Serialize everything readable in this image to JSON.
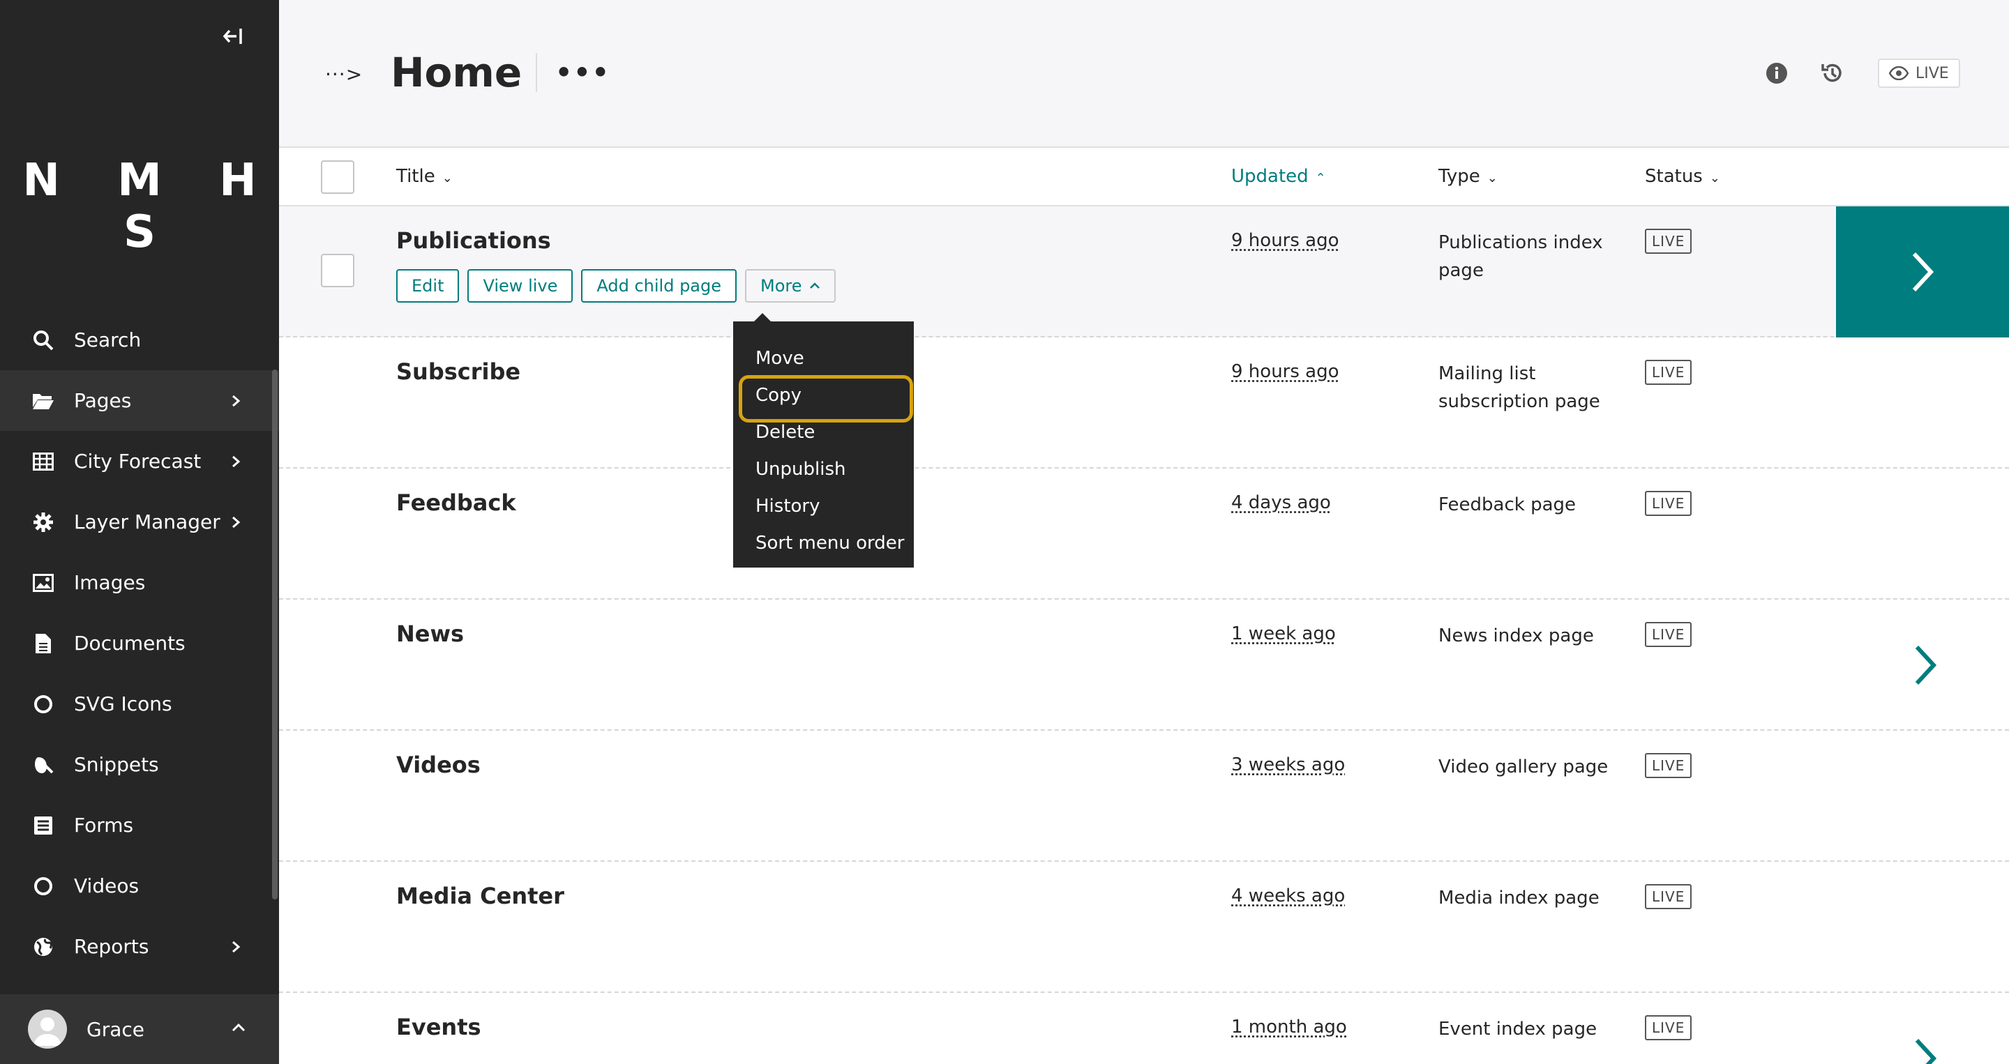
{
  "sidebar": {
    "logo": "N M H S",
    "items": [
      {
        "label": "Search",
        "icon": "search-icon",
        "has_children": false
      },
      {
        "label": "Pages",
        "icon": "folder-open-icon",
        "has_children": true
      },
      {
        "label": "City Forecast",
        "icon": "table-icon",
        "has_children": true
      },
      {
        "label": "Layer Manager",
        "icon": "gear-icon",
        "has_children": true
      },
      {
        "label": "Images",
        "icon": "image-icon",
        "has_children": false
      },
      {
        "label": "Documents",
        "icon": "document-icon",
        "has_children": false
      },
      {
        "label": "SVG Icons",
        "icon": "circle-icon",
        "has_children": false
      },
      {
        "label": "Snippets",
        "icon": "snippet-icon",
        "has_children": false
      },
      {
        "label": "Forms",
        "icon": "form-icon",
        "has_children": false
      },
      {
        "label": "Videos",
        "icon": "circle-icon",
        "has_children": false
      },
      {
        "label": "Reports",
        "icon": "globe-icon",
        "has_children": true
      }
    ],
    "account_name": "Grace"
  },
  "header": {
    "breadcrumb_toggle": "···>",
    "title": "Home",
    "more": "•••",
    "live_label": "LIVE"
  },
  "table": {
    "columns": {
      "title": "Title",
      "updated": "Updated",
      "type": "Type",
      "status": "Status"
    },
    "rows": [
      {
        "title": "Publications",
        "updated": "9 hours ago",
        "type": "Publications index page",
        "status": "LIVE"
      },
      {
        "title": "Subscribe",
        "updated": "9 hours ago",
        "type": "Mailing list subscription page",
        "status": "LIVE"
      },
      {
        "title": "Feedback",
        "updated": "4 days ago",
        "type": "Feedback page",
        "status": "LIVE"
      },
      {
        "title": "News",
        "updated": "1 week ago",
        "type": "News index page",
        "status": "LIVE"
      },
      {
        "title": "Videos",
        "updated": "3 weeks ago",
        "type": "Video gallery page",
        "status": "LIVE"
      },
      {
        "title": "Media Center",
        "updated": "4 weeks ago",
        "type": "Media index page",
        "status": "LIVE"
      },
      {
        "title": "Events",
        "updated": "1 month ago",
        "type": "Event index page",
        "status": "LIVE"
      }
    ],
    "row_actions": {
      "edit": "Edit",
      "view_live": "View live",
      "add_child": "Add child page",
      "more": "More"
    }
  },
  "dropdown": {
    "items": [
      "Move",
      "Copy",
      "Delete",
      "Unpublish",
      "History",
      "Sort menu order"
    ],
    "focused": "Copy"
  },
  "colors": {
    "accent": "#007d7e",
    "sidebar_bg": "#262626",
    "focus_ring": "#d7a311"
  }
}
